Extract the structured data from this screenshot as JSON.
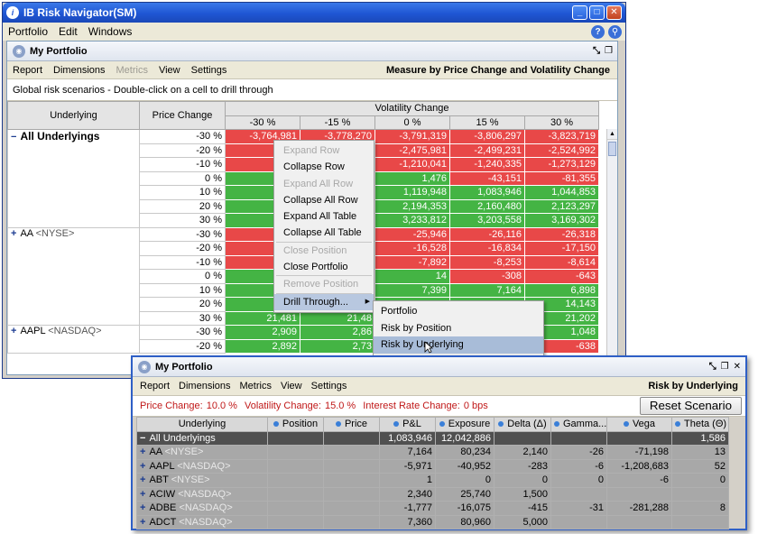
{
  "window": {
    "title": "IB Risk Navigator(SM)",
    "menu": [
      "Portfolio",
      "Edit",
      "Windows"
    ]
  },
  "panel1": {
    "title": "My Portfolio",
    "menu": [
      "Report",
      "Dimensions",
      "Metrics",
      "View",
      "Settings"
    ],
    "heading": "Measure by Price Change and Volatility Change",
    "info": "Global risk scenarios - Double-click on a cell to drill through",
    "col_underlying": "Underlying",
    "col_price_change": "Price Change",
    "col_volatility": "Volatility Change",
    "vol_cols": [
      "-30 %",
      "-15 %",
      "0 %",
      "15 %",
      "30 %"
    ],
    "groups": [
      {
        "name": "All Underlyings",
        "bold": true,
        "rows": [
          {
            "pc": "-30 %",
            "v": [
              "-3,764,981",
              "-3,778,270",
              "-3,791,319",
              "-3,806,297",
              "-3,823,719"
            ],
            "c": "r"
          },
          {
            "pc": "-20 %",
            "v": [
              "-2,43",
              "",
              "-2,475,981",
              "-2,499,231",
              "-2,524,992"
            ],
            "c": "r"
          },
          {
            "pc": "-10 %",
            "v": [
              "-1,15",
              "",
              "-1,210,041",
              "-1,240,335",
              "-1,273,129"
            ],
            "c": "r"
          },
          {
            "pc": "0 %",
            "v": [
              "5",
              "",
              "1,476",
              "-43,151",
              "-81,355"
            ],
            "c": "m"
          },
          {
            "pc": "10 %",
            "v": [
              "1,17",
              "",
              "1,119,948",
              "1,083,946",
              "1,044,853"
            ],
            "c": "g"
          },
          {
            "pc": "20 %",
            "v": [
              "2,24",
              "",
              "2,194,353",
              "2,160,480",
              "2,123,297"
            ],
            "c": "g"
          },
          {
            "pc": "30 %",
            "v": [
              "3,27",
              "",
              "3,233,812",
              "3,203,558",
              "3,169,302"
            ],
            "c": "g"
          }
        ]
      },
      {
        "name": "AA",
        "exch": "<NYSE>",
        "rows": [
          {
            "pc": "-30 %",
            "v": [
              "-2",
              "",
              "-25,946",
              "-26,116",
              "-26,318"
            ],
            "c": "r"
          },
          {
            "pc": "-20 %",
            "v": [
              "-1",
              "",
              "-16,528",
              "-16,834",
              "-17,150"
            ],
            "c": "r"
          },
          {
            "pc": "-10 %",
            "v": [
              "",
              "",
              "-7,892",
              "-8,253",
              "-8,614"
            ],
            "c": "r"
          },
          {
            "pc": "0 %",
            "v": [
              "",
              "",
              "14",
              "-308",
              "-643"
            ],
            "c": "m"
          },
          {
            "pc": "10 %",
            "v": [
              "",
              "",
              "7,399",
              "7,164",
              "6,898"
            ],
            "c": "g"
          },
          {
            "pc": "20 %",
            "v": [
              "1",
              "",
              "",
              "",
              "14,143"
            ],
            "c": "g"
          },
          {
            "pc": "30 %",
            "v": [
              "21,481",
              "21,48",
              "",
              "",
              "21,202"
            ],
            "c": "g"
          }
        ]
      },
      {
        "name": "AAPL",
        "exch": "<NASDAQ>",
        "rows": [
          {
            "pc": "-30 %",
            "v": [
              "2,909",
              "2,86",
              "",
              "",
              "1,048"
            ],
            "c": "g"
          },
          {
            "pc": "-20 %",
            "v": [
              "2,892",
              "2,73",
              "",
              "",
              "-638"
            ],
            "c": "m2"
          }
        ]
      }
    ]
  },
  "context_menu": [
    {
      "label": "Expand Row",
      "disabled": true
    },
    {
      "label": "Collapse Row"
    },
    {
      "label": "Expand All Row",
      "disabled": true
    },
    {
      "label": "Collapse All Row"
    },
    {
      "label": "Expand All Table"
    },
    {
      "label": "Collapse All Table"
    },
    {
      "sep": true
    },
    {
      "label": "Close Position",
      "disabled": true
    },
    {
      "label": "Close Portfolio"
    },
    {
      "sep": true
    },
    {
      "label": "Remove Position",
      "disabled": true
    },
    {
      "sep": true
    },
    {
      "label": "Drill Through...",
      "highlight": true
    }
  ],
  "submenu": [
    "Portfolio",
    "Risk by Position",
    "Risk by Underlying"
  ],
  "panel2": {
    "title": "My Portfolio",
    "menu": [
      "Report",
      "Dimensions",
      "Metrics",
      "View",
      "Settings"
    ],
    "heading": "Risk by Underlying",
    "price_change_label": "Price Change:",
    "price_change": "10.0 %",
    "vol_change_label": "Volatility Change:",
    "vol_change": "15.0 %",
    "ir_change_label": "Interest Rate Change:",
    "ir_change": "0 bps",
    "reset": "Reset Scenario",
    "columns": [
      "Underlying",
      "Position",
      "Price",
      "P&L",
      "Exposure",
      "Delta (Δ)",
      "Gamma...",
      "Vega",
      "Theta (Θ)"
    ],
    "rows": [
      {
        "name": "All Underlyings",
        "exch": "",
        "cells": [
          "",
          "",
          "1,083,946",
          "12,042,886",
          "",
          "",
          "",
          "1,586"
        ],
        "total": true
      },
      {
        "name": "AA",
        "exch": "<NYSE>",
        "cells": [
          "",
          "",
          "7,164",
          "80,234",
          "2,140",
          "-26",
          "-71,198",
          "13"
        ]
      },
      {
        "name": "AAPL",
        "exch": "<NASDAQ>",
        "cells": [
          "",
          "",
          "-5,971",
          "-40,952",
          "-283",
          "-6",
          "-1,208,683",
          "52"
        ]
      },
      {
        "name": "ABT",
        "exch": "<NYSE>",
        "cells": [
          "",
          "",
          "1",
          "0",
          "0",
          "0",
          "-6",
          "0"
        ]
      },
      {
        "name": "ACIW",
        "exch": "<NASDAQ>",
        "cells": [
          "",
          "",
          "2,340",
          "25,740",
          "1,500",
          "",
          "",
          ""
        ]
      },
      {
        "name": "ADBE",
        "exch": "<NASDAQ>",
        "cells": [
          "",
          "",
          "-1,777",
          "-16,075",
          "-415",
          "-31",
          "-281,288",
          "8"
        ]
      },
      {
        "name": "ADCT",
        "exch": "<NASDAQ>",
        "cells": [
          "",
          "",
          "7,360",
          "80,960",
          "5,000",
          "",
          "",
          ""
        ]
      }
    ]
  }
}
